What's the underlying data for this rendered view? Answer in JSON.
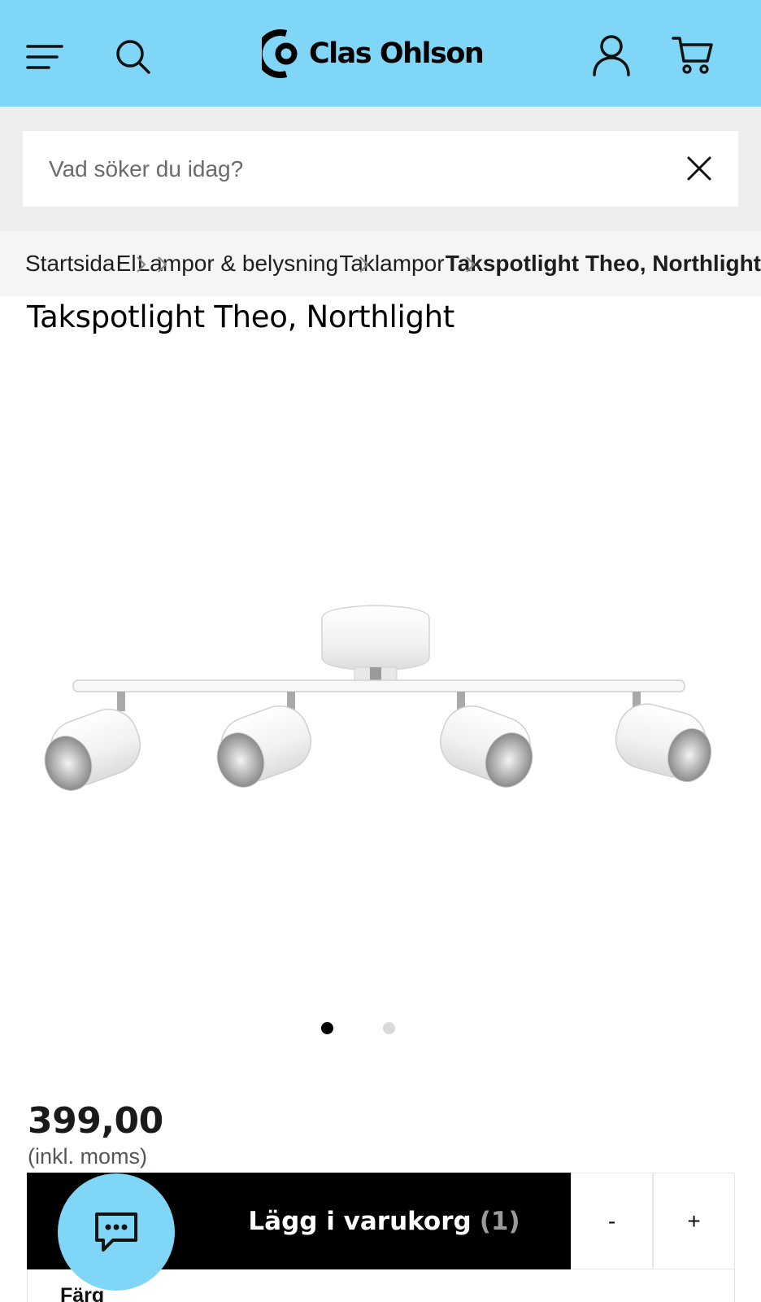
{
  "header": {
    "logo_text": "Clas Ohlson",
    "menu_icon": "hamburger-menu-icon",
    "search_icon": "search-icon",
    "account_icon": "user-icon",
    "cart_icon": "cart-icon",
    "background_color": "#7fd6f7"
  },
  "search": {
    "placeholder": "Vad söker du idag?",
    "value": "",
    "clear_icon": "close-icon"
  },
  "breadcrumb": {
    "items": [
      "Startsida",
      "El",
      "Lampor & belysning",
      "Taklampor",
      "Takspotlight Theo, Northlight"
    ],
    "separator_icon": "chevron-right-icon"
  },
  "product": {
    "title": "Takspotlight Theo, Northlight",
    "image_count": 2,
    "active_image": 1,
    "price": "399,00",
    "price_note": "(inkl. moms)"
  },
  "cart": {
    "add_label": "Lägg i varukorg",
    "quantity_display": "(1)",
    "decrement_label": "-",
    "increment_label": "+"
  },
  "variant": {
    "label": "Färg"
  },
  "chat": {
    "icon": "chat-bubble-icon"
  }
}
